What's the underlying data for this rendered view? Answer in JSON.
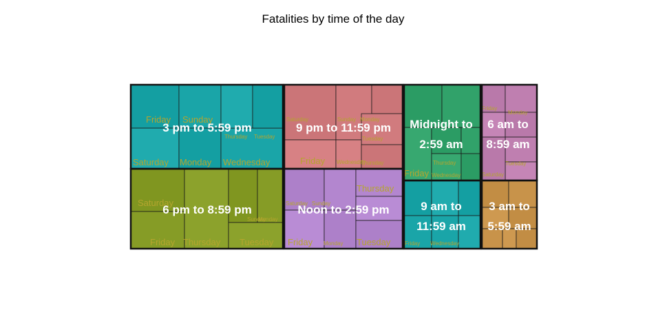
{
  "chart_data": {
    "type": "treemap",
    "title": "Fatalities by time of the day",
    "groups": [
      {
        "label": "3 pm to 5:59 pm",
        "label_lines": [
          "3 pm to 5:59 pm"
        ],
        "color": "#1aa5a8",
        "days": [
          {
            "label": "Friday"
          },
          {
            "label": "Sunday"
          },
          {
            "label": "Saturday"
          },
          {
            "label": "Monday"
          },
          {
            "label": "Wednesday"
          },
          {
            "label": "Thursday"
          },
          {
            "label": "Tuesday"
          }
        ]
      },
      {
        "label": "9 pm to 11:59 pm",
        "label_lines": [
          "9 pm to 11:59 pm"
        ],
        "color": "#d17b7e",
        "days": [
          {
            "label": "Saturday"
          },
          {
            "label": "Sunday"
          },
          {
            "label": "Friday"
          },
          {
            "label": "Monday"
          },
          {
            "label": "Tuesday"
          },
          {
            "label": "Wednesday"
          },
          {
            "label": "Thursday"
          }
        ]
      },
      {
        "label": "Midnight to 2:59 am",
        "label_lines": [
          "Midnight to",
          "2:59 am"
        ],
        "color": "#31a26a",
        "days": [
          {
            "label": "Sunday"
          },
          {
            "label": "Saturday"
          },
          {
            "label": "Friday"
          },
          {
            "label": "Thursday"
          },
          {
            "label": "Monday"
          },
          {
            "label": "Tuesday"
          },
          {
            "label": "Wednesday"
          }
        ]
      },
      {
        "label": "6 am to 8:59 am",
        "label_lines": [
          "6 am to",
          "8:59 am"
        ],
        "color": "#bf7fb0",
        "days": [
          {
            "label": "Friday"
          },
          {
            "label": "Monday"
          },
          {
            "label": "Thursday"
          },
          {
            "label": "Sunday"
          },
          {
            "label": "Tuesday"
          },
          {
            "label": "Wednesday"
          },
          {
            "label": "Saturday"
          }
        ]
      },
      {
        "label": "6 pm to 8:59 pm",
        "label_lines": [
          "6 pm to 8:59 pm"
        ],
        "color": "#869c26",
        "days": [
          {
            "label": "Saturday"
          },
          {
            "label": "Friday"
          },
          {
            "label": "Thursday"
          },
          {
            "label": "Sunday"
          },
          {
            "label": "Monday"
          },
          {
            "label": "Tuesday"
          },
          {
            "label": "Wednesday"
          }
        ]
      },
      {
        "label": "Noon to 2:59 pm",
        "label_lines": [
          "Noon to 2:59 pm"
        ],
        "color": "#b386cf",
        "days": [
          {
            "label": "Saturday"
          },
          {
            "label": "Sunday"
          },
          {
            "label": "Friday"
          },
          {
            "label": "Monday"
          },
          {
            "label": "Thursday"
          },
          {
            "label": "Wednesday"
          },
          {
            "label": "Tuesday"
          }
        ]
      },
      {
        "label": "9 am to 11:59 am",
        "label_lines": [
          "9 am to",
          "11:59 am"
        ],
        "color": "#1aa5a8",
        "days": [
          {
            "label": "Friday"
          },
          {
            "label": "Wednesday"
          },
          {
            "label": "Monday"
          },
          {
            "label": "Thursday"
          },
          {
            "label": "Tuesday"
          },
          {
            "label": "Saturday"
          },
          {
            "label": "Sunday"
          }
        ]
      },
      {
        "label": "3 am to 5:59 am",
        "label_lines": [
          "3 am to",
          "5:59 am"
        ],
        "color": "#c8934a",
        "days": [
          {
            "label": "Monday"
          },
          {
            "label": "Thursday"
          },
          {
            "label": "Friday"
          },
          {
            "label": "Tuesday"
          },
          {
            "label": "Wednesday"
          },
          {
            "label": "Saturday"
          },
          {
            "label": "Sunday"
          }
        ]
      }
    ]
  }
}
